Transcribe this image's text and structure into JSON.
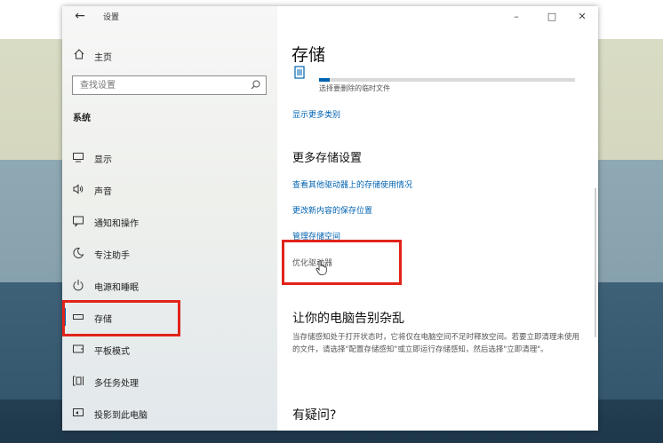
{
  "window": {
    "title": "设置",
    "controls": [
      "minimize",
      "maximize",
      "close"
    ]
  },
  "sidebar": {
    "home_label": "主页",
    "search_placeholder": "查找设置",
    "section_title": "系统",
    "items": [
      {
        "label": "显示",
        "icon": "monitor-icon"
      },
      {
        "label": "声音",
        "icon": "speaker-icon"
      },
      {
        "label": "通知和操作",
        "icon": "notification-icon"
      },
      {
        "label": "专注助手",
        "icon": "moon-icon"
      },
      {
        "label": "电源和睡眠",
        "icon": "power-icon"
      },
      {
        "label": "存储",
        "icon": "storage-icon",
        "active": true
      },
      {
        "label": "平板模式",
        "icon": "tablet-icon"
      },
      {
        "label": "多任务处理",
        "icon": "multitask-icon"
      },
      {
        "label": "投影到此电脑",
        "icon": "project-icon"
      }
    ]
  },
  "content": {
    "title": "存储",
    "temp_note": "选择要删除的临时文件",
    "usage_fraction": 0.04,
    "show_more_link": "显示更多类别",
    "more_settings_heading": "更多存储设置",
    "links": [
      "查看其他驱动器上的存储使用情况",
      "更改新内容的保存位置",
      "管理存储空间"
    ],
    "optimize_link": "优化驱动器",
    "declutter_heading": "让你的电脑告别杂乱",
    "declutter_text": "当存储感知处于打开状态时，它将仅在电脑空间不足时释放空间。若要立即清理未使用的文件，请选择\"配置存储感知\"或立即运行存储感知，然后选择\"立即清理\"。",
    "question_heading": "有疑问?"
  },
  "colors": {
    "accent": "#0063b1",
    "highlight_box": "#e2231a"
  }
}
